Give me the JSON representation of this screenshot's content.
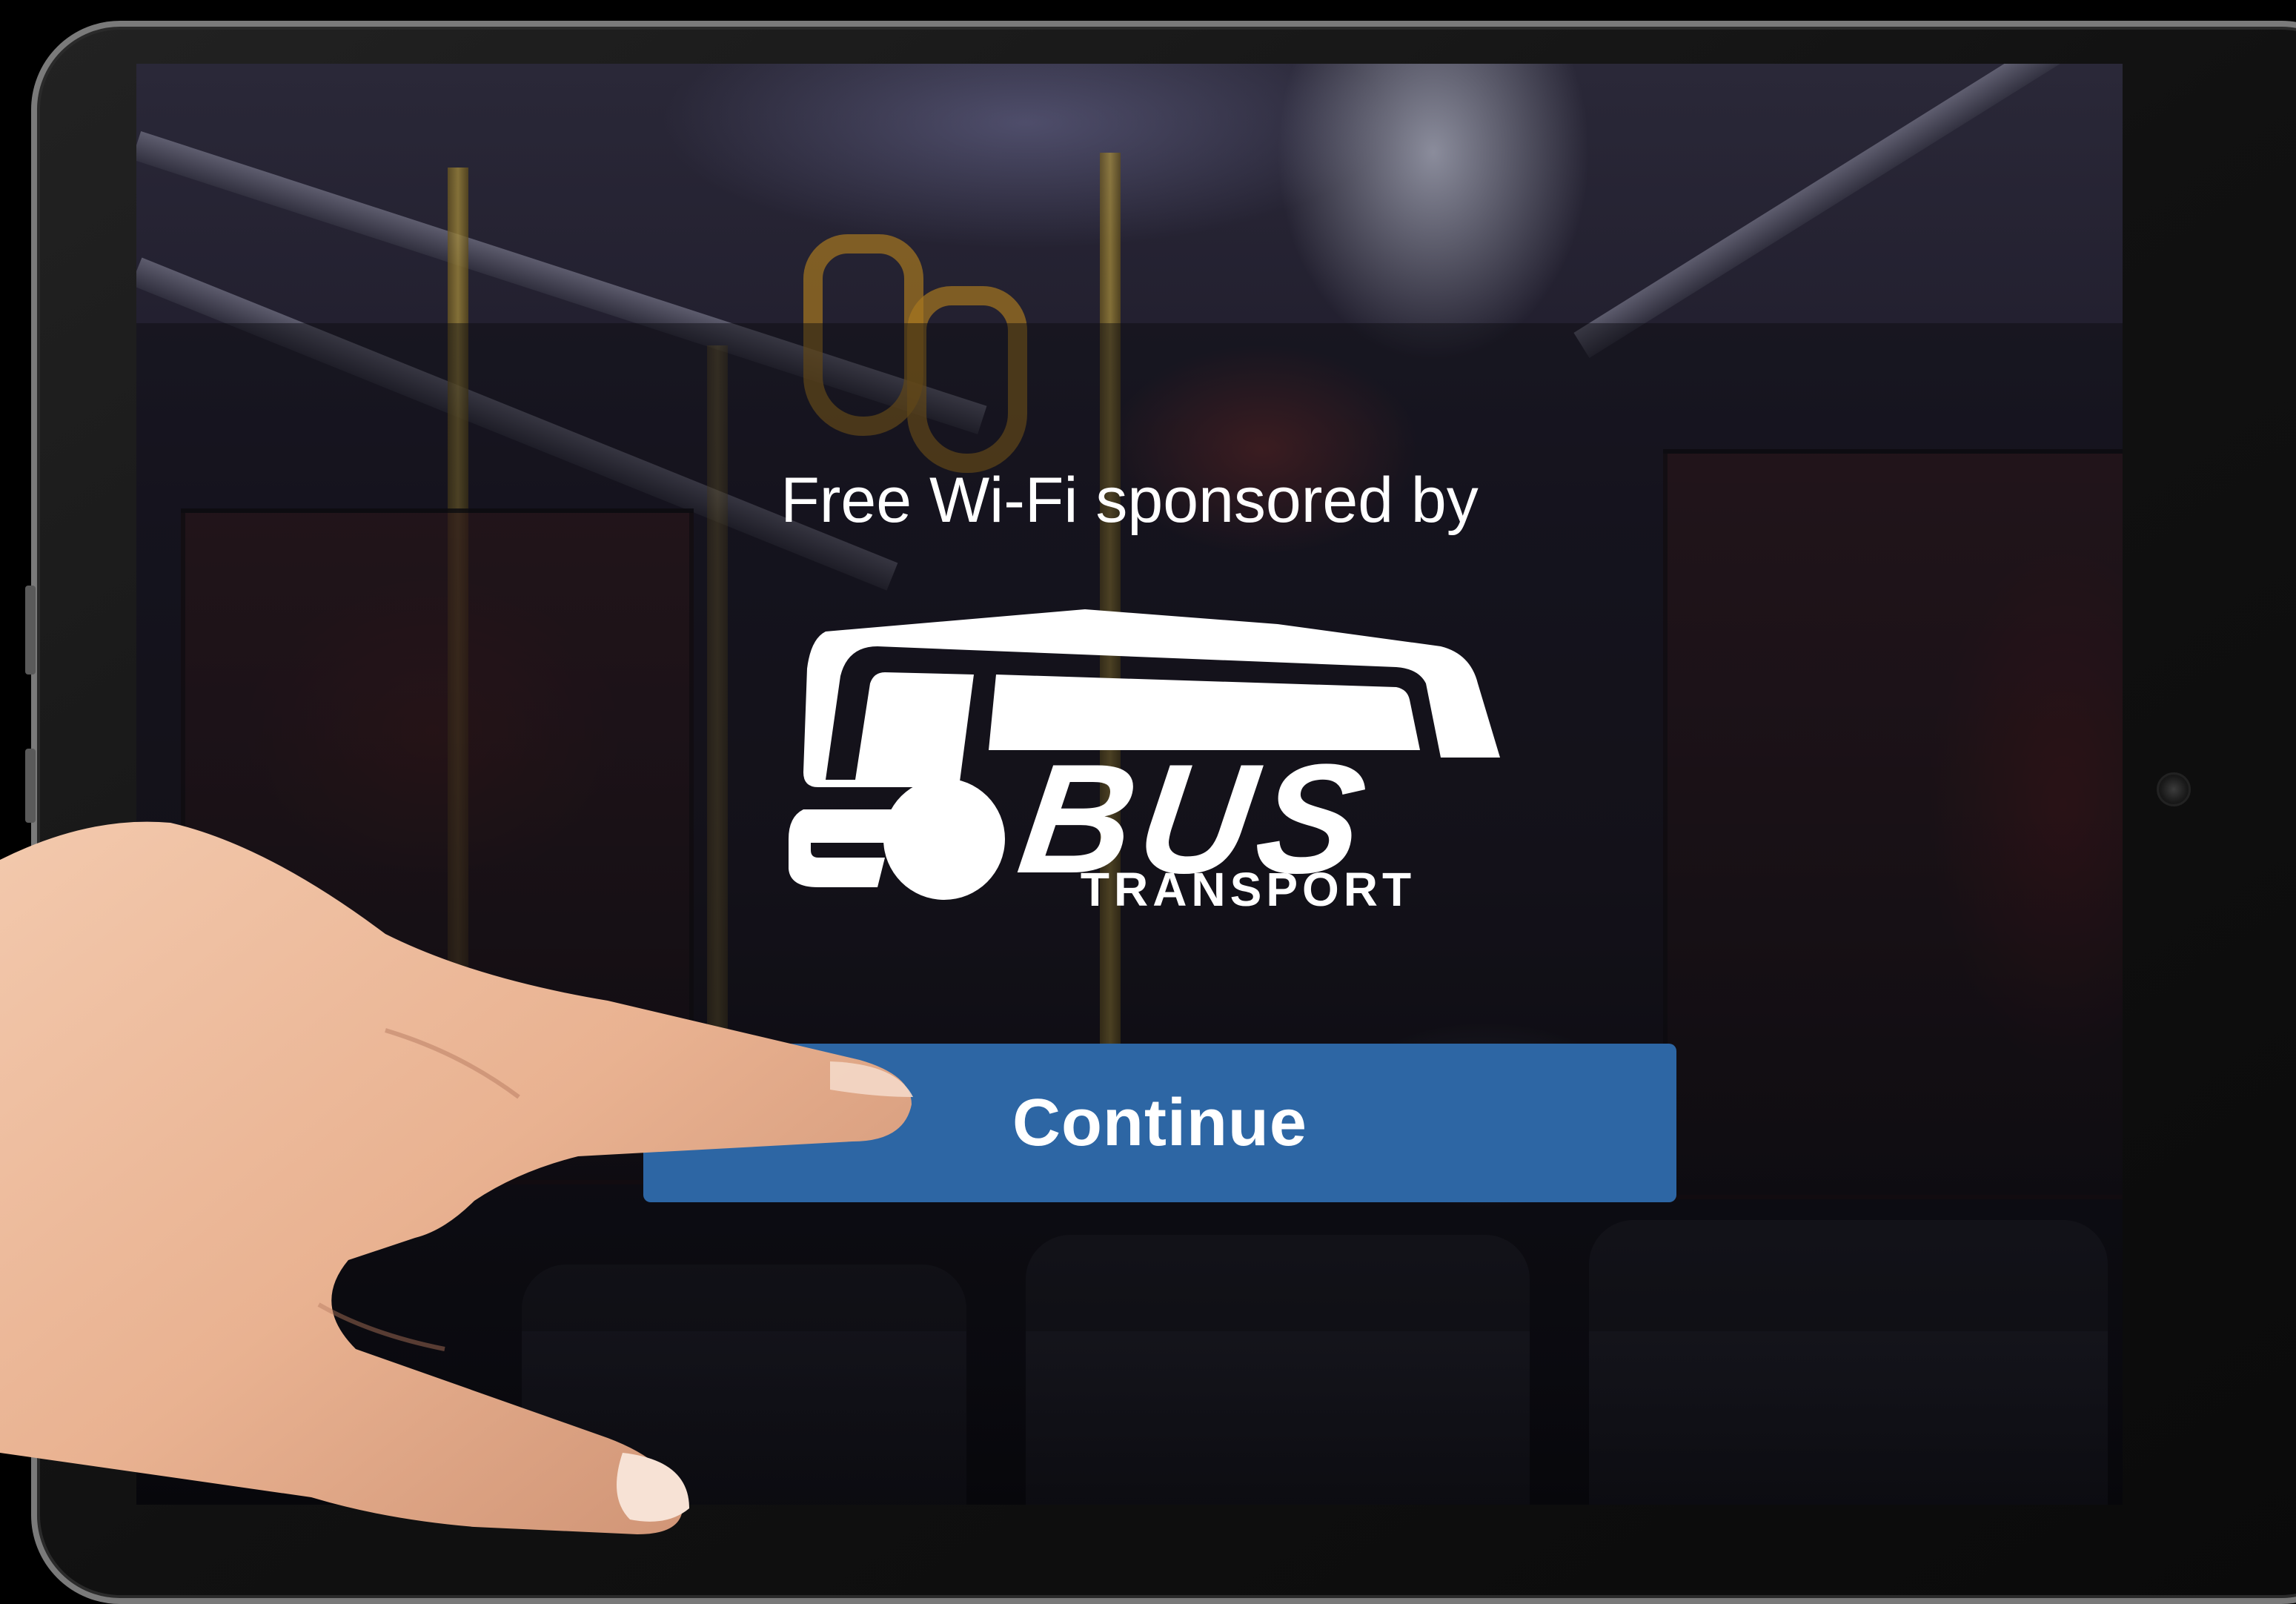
{
  "portal": {
    "headline": "Free Wi-Fi sponsored by",
    "continue_label": "Continue"
  },
  "logo": {
    "name": "BUS",
    "subtitle": "TRANSPORT"
  },
  "colors": {
    "button": "#2d66a4",
    "text": "#ffffff",
    "bezel": "#111111"
  }
}
